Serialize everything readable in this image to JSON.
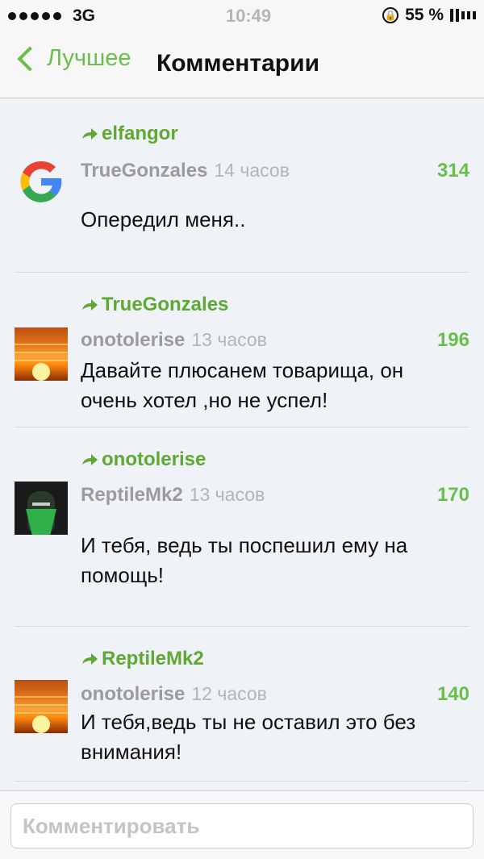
{
  "status_bar": {
    "carrier": "3G",
    "time": "10:49",
    "battery": "55 %"
  },
  "nav": {
    "back_label": "Лучшее",
    "title": "Комментарии"
  },
  "comments": [
    {
      "reply_to": "elfangor",
      "author": "TrueGonzales",
      "time": "14 часов",
      "score": "314",
      "text": "Опередил меня..",
      "avatar": "google-logo-icon"
    },
    {
      "reply_to": "TrueGonzales",
      "author": "onotolerise",
      "time": "13 часов",
      "score": "196",
      "text": "Давайте плюсанем товарища, он очень хотел ,но не успел!",
      "avatar": "sunset-avatar"
    },
    {
      "reply_to": "onotolerise",
      "author": "ReptileMk2",
      "time": "13 часов",
      "score": "170",
      "text": "И тебя, ведь ты поспешил ему на помощь!",
      "avatar": "reptile-avatar"
    },
    {
      "reply_to": "ReptileMk2",
      "author": "onotolerise",
      "time": "12 часов",
      "score": "140",
      "text": "И тебя,ведь ты не оставил это без внимания!",
      "avatar": "sunset-avatar"
    }
  ],
  "input": {
    "placeholder": "Комментировать"
  },
  "colors": {
    "accent_green": "#6abf4b",
    "background": "#eff2f6"
  }
}
